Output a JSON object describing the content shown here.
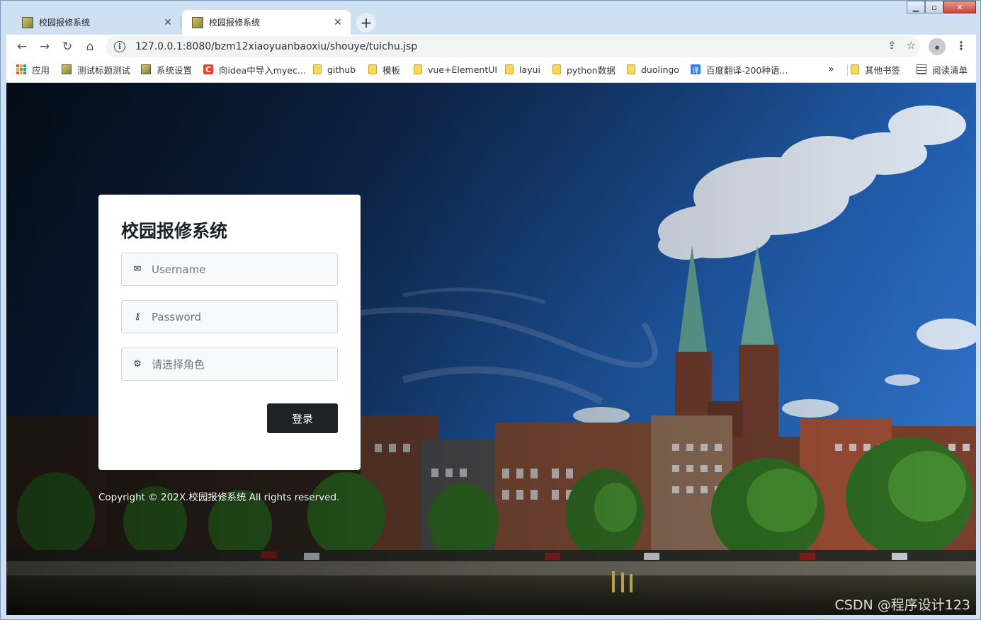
{
  "browser": {
    "tabs": [
      {
        "title": "校园报修系统",
        "close": "✕"
      },
      {
        "title": "校园报修系统",
        "close": "✕"
      }
    ],
    "new_tab": "+",
    "url": "127.0.0.1:8080/bzm12xiaoyuanbaoxiu/shouye/tuichu.jsp",
    "bookmarks": [
      {
        "label": "应用",
        "icon": "apps-icon"
      },
      {
        "label": "测试标题测试",
        "icon": "image-icon"
      },
      {
        "label": "系统设置",
        "icon": "image-icon"
      },
      {
        "label": "向idea中导入myec...",
        "icon": "csdn-icon"
      },
      {
        "label": "github",
        "icon": "folder-icon"
      },
      {
        "label": "模板",
        "icon": "folder-icon"
      },
      {
        "label": "vue+ElementUI",
        "icon": "folder-icon"
      },
      {
        "label": "layui",
        "icon": "folder-icon"
      },
      {
        "label": "python数据",
        "icon": "folder-icon"
      },
      {
        "label": "duolingo",
        "icon": "folder-icon"
      },
      {
        "label": "百度翻译-200种语...",
        "icon": "translate-icon"
      },
      {
        "label": "其他书签",
        "icon": "folder-icon"
      },
      {
        "label": "阅读清单",
        "icon": "reading-list-icon"
      }
    ],
    "overflow": "»"
  },
  "login": {
    "title": "校园报修系统",
    "username_placeholder": "Username",
    "password_placeholder": "Password",
    "role_placeholder": "请选择角色",
    "submit": "登录"
  },
  "footer": {
    "copyright": "Copyright © 202X.校园报修系统 All rights reserved."
  },
  "watermark": "CSDN @程序设计123"
}
